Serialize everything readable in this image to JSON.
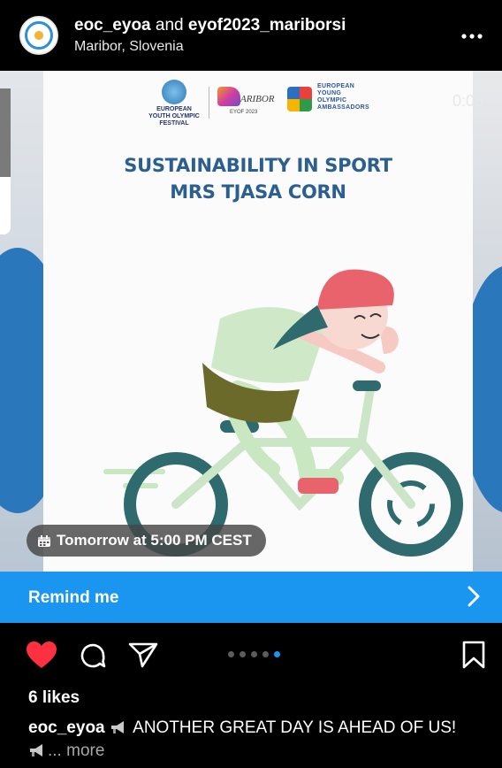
{
  "header": {
    "user1": "eoc_eyoa",
    "joiner": "and",
    "user2": "eyof2023_mariborsi",
    "location": "Maribor, Slovenia",
    "more_icon": "more-horizontal-icon"
  },
  "media": {
    "timer": "0:05",
    "logos": {
      "eyof_line1": "EUROPEAN",
      "eyof_line2": "YOUTH OLYMPIC",
      "eyof_line3": "FESTIVAL",
      "maribor_name": "ARIBOR",
      "maribor_sub": "EYOF 2023",
      "ambassadors": [
        "EUROPEAN",
        "YOUNG",
        "OLYMPIC",
        "AMBASSADORS"
      ]
    },
    "headline_line1": "SUSTAINABILITY IN SPORT",
    "headline_line2": "MRS TJASA CORN",
    "event_time": "Tomorrow at 5:00 PM CEST"
  },
  "remind": {
    "label": "Remind me",
    "icon": "chevron-right-icon"
  },
  "actions": {
    "like_icon": "heart-icon",
    "comment_icon": "comment-icon",
    "share_icon": "send-icon",
    "save_icon": "bookmark-icon",
    "carousel_dots": 5,
    "active_dot": 5
  },
  "post": {
    "likes": "6 likes",
    "caption_user": "eoc_eyoa",
    "caption_text": "ANOTHER GREAT DAY IS AHEAD OF US!",
    "more": "... more"
  },
  "colors": {
    "accent_blue": "#1a95f0",
    "like_red": "#ff3040",
    "headline_blue": "#2b5f8f"
  }
}
